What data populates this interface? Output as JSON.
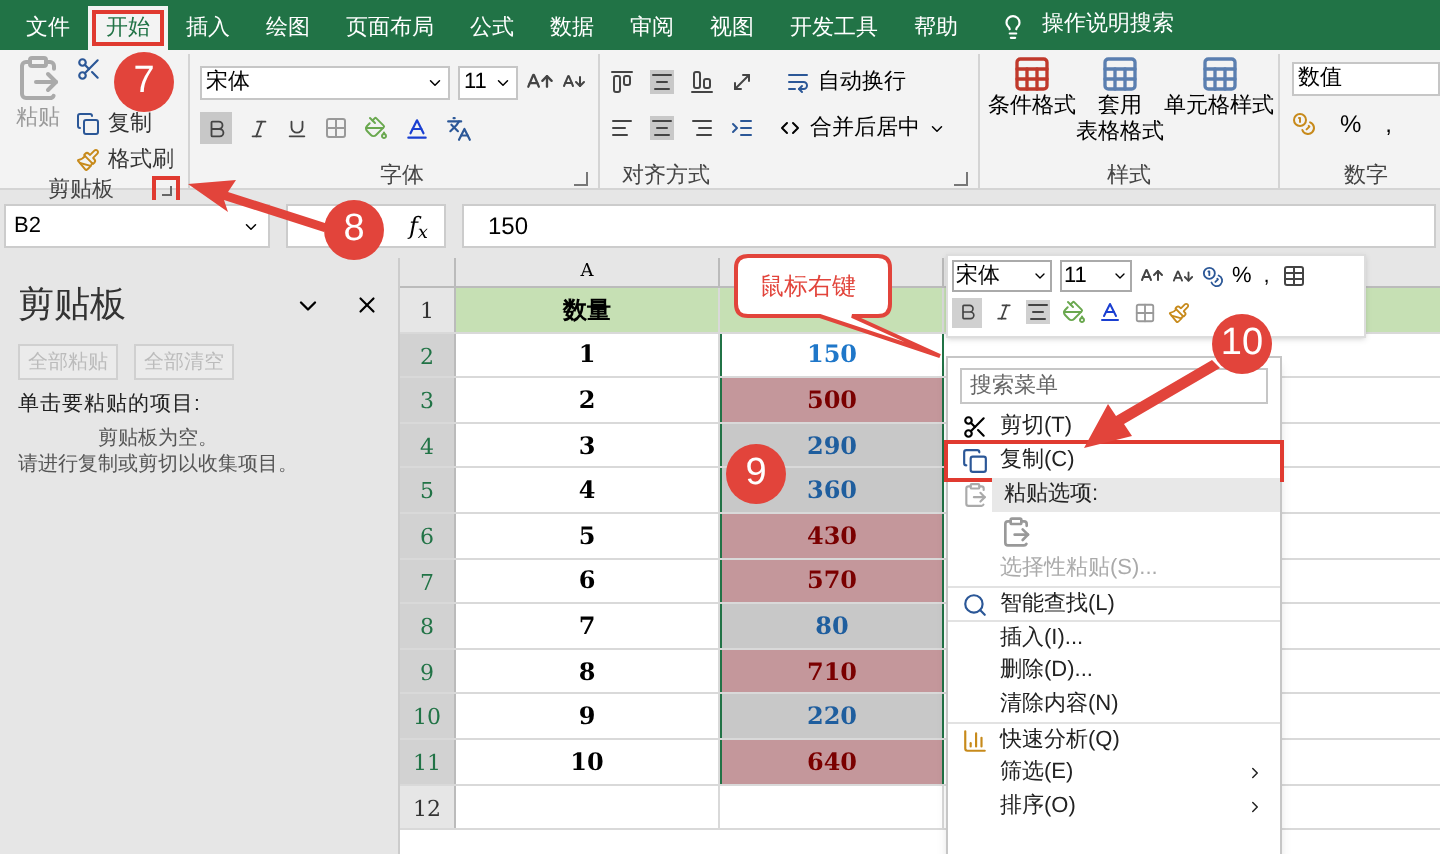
{
  "ribbon_tabs": [
    {
      "label": "文件",
      "selected": false
    },
    {
      "label": "开始",
      "selected": true
    },
    {
      "label": "插入",
      "selected": false
    },
    {
      "label": "绘图",
      "selected": false
    },
    {
      "label": "页面布局",
      "selected": false
    },
    {
      "label": "公式",
      "selected": false
    },
    {
      "label": "数据",
      "selected": false
    },
    {
      "label": "审阅",
      "selected": false
    },
    {
      "label": "视图",
      "selected": false
    },
    {
      "label": "开发工具",
      "selected": false
    },
    {
      "label": "帮助",
      "selected": false
    }
  ],
  "tell_me": "操作说明搜索",
  "ribbon": {
    "clipboard": {
      "paste": "粘贴",
      "copy": "复制",
      "format_painter": "格式刷",
      "label": "剪贴板"
    },
    "font": {
      "name": "宋体",
      "size": "11",
      "label": "字体"
    },
    "alignment": {
      "wrap": "自动换行",
      "merge": "合并后居中",
      "label": "对齐方式"
    },
    "styles": {
      "items": [
        {
          "lines": [
            "条件格式"
          ]
        },
        {
          "lines": [
            "套用",
            "表格格式"
          ]
        },
        {
          "lines": [
            "单元格样式"
          ]
        }
      ],
      "label": "样式"
    },
    "number": {
      "format": "数值",
      "percent": "%",
      "comma": ",",
      "label": "数字"
    }
  },
  "formula_bar": {
    "name_box": "B2",
    "fx": "f$_{x}$",
    "value": "150"
  },
  "clipboard_pane": {
    "title": "剪贴板",
    "buttons": [
      "全部粘贴",
      "全部清空"
    ],
    "prompt": "单击要粘贴的项目:",
    "empty_lines": [
      "剪贴板为空。",
      "请进行复制或剪切以收集项目。"
    ]
  },
  "sheet": {
    "column_a": "A",
    "rows": [
      {
        "n": "1",
        "a": "数量",
        "b": "",
        "kind": "header"
      },
      {
        "n": "2",
        "a": "1",
        "b": "150",
        "kind": "plain"
      },
      {
        "n": "3",
        "a": "2",
        "b": "500",
        "kind": "high"
      },
      {
        "n": "4",
        "a": "3",
        "b": "290",
        "kind": "low"
      },
      {
        "n": "5",
        "a": "4",
        "b": "360",
        "kind": "low"
      },
      {
        "n": "6",
        "a": "5",
        "b": "430",
        "kind": "high"
      },
      {
        "n": "7",
        "a": "6",
        "b": "570",
        "kind": "high"
      },
      {
        "n": "8",
        "a": "7",
        "b": "80",
        "kind": "low"
      },
      {
        "n": "9",
        "a": "8",
        "b": "710",
        "kind": "high"
      },
      {
        "n": "10",
        "a": "9",
        "b": "220",
        "kind": "low"
      },
      {
        "n": "11",
        "a": "10",
        "b": "640",
        "kind": "high"
      },
      {
        "n": "12",
        "a": "",
        "b": "",
        "kind": "empty"
      }
    ]
  },
  "mini_toolbar": {
    "font": "宋体",
    "size": "11",
    "percent": "%",
    "comma": ","
  },
  "context_menu": {
    "placeholder": "搜索菜单",
    "items": [
      {
        "kind": "cut",
        "label": "剪切(T)",
        "disabled": false,
        "annotated": false,
        "submenu": false
      },
      {
        "kind": "copy",
        "label": "复制(C)",
        "disabled": false,
        "annotated": true,
        "submenu": false
      },
      {
        "kind": "paste-header",
        "label": "粘贴选项:",
        "disabled": false,
        "annotated": false,
        "submenu": false
      },
      {
        "kind": "paste-icons",
        "disabled": false,
        "annotated": false,
        "submenu": false
      },
      {
        "kind": "item",
        "label": "选择性粘贴(S)...",
        "disabled": true,
        "annotated": false,
        "submenu": false
      },
      {
        "kind": "lookup",
        "label": "智能查找(L)",
        "disabled": false,
        "annotated": false,
        "submenu": false
      },
      {
        "kind": "item",
        "label": "插入(I)...",
        "disabled": false,
        "annotated": false,
        "submenu": false
      },
      {
        "kind": "item",
        "label": "删除(D)...",
        "disabled": false,
        "annotated": false,
        "submenu": false
      },
      {
        "kind": "item",
        "label": "清除内容(N)",
        "disabled": false,
        "annotated": false,
        "submenu": false
      },
      {
        "kind": "analysis",
        "label": "快速分析(Q)",
        "disabled": false,
        "annotated": false,
        "submenu": false
      },
      {
        "kind": "item",
        "label": "筛选(E)",
        "disabled": false,
        "annotated": false,
        "submenu": true
      },
      {
        "kind": "item",
        "label": "排序(O)",
        "disabled": false,
        "annotated": false,
        "submenu": true
      }
    ]
  },
  "callout": "鼠标右键",
  "step_markers": [
    "7",
    "8",
    "9",
    "10"
  ]
}
